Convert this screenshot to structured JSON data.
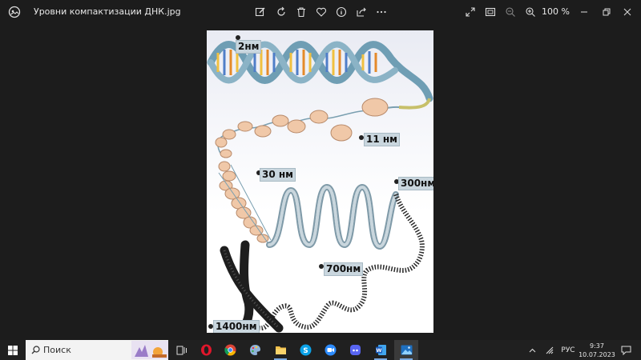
{
  "window": {
    "title": "Уровни компактизации ДНК.jpg",
    "zoom": "100 %"
  },
  "image_labels": {
    "l2nm": "2нм",
    "l11nm": "11 нм",
    "l30nm": "30 нм",
    "l300nm": "300нм",
    "l700nm": "700нм",
    "l1400nm": "1400нм"
  },
  "taskbar": {
    "search_placeholder": "Поиск",
    "language": "РУС",
    "time": "9:37",
    "date": "10.07.2023"
  },
  "colors": {
    "window_bg": "#1c1c1c",
    "taskbar_bg": "#202020",
    "label_bg": "#c9d6de",
    "accent": "#7aa9e0"
  }
}
